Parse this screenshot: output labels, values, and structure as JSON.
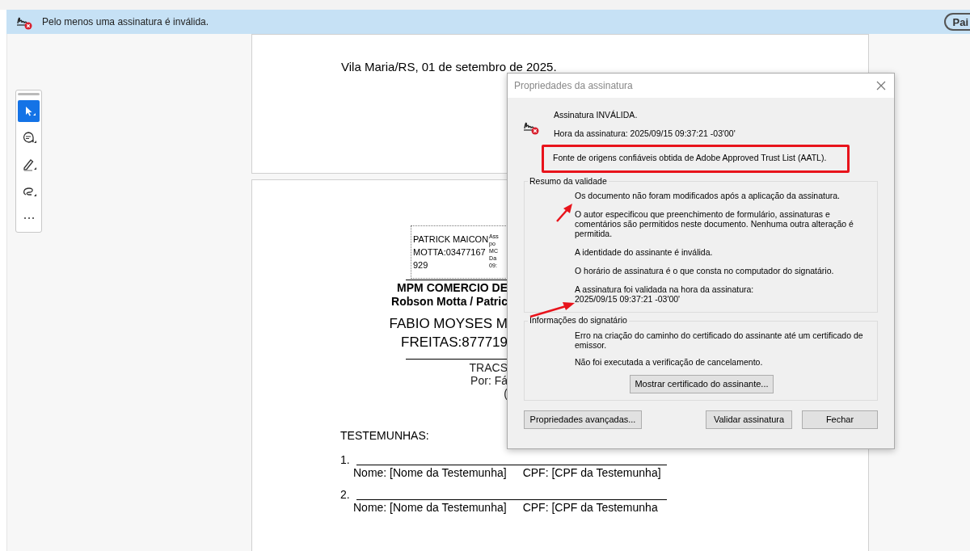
{
  "banner": {
    "message": "Pelo menos uma assinatura é inválida.",
    "button": "Pai"
  },
  "toolbar": {
    "tools": [
      {
        "kind": "select",
        "selected": true
      },
      {
        "kind": "comment",
        "selected": false
      },
      {
        "kind": "draw",
        "selected": false
      },
      {
        "kind": "lasso",
        "selected": false
      },
      {
        "kind": "more",
        "selected": false
      }
    ]
  },
  "document": {
    "place_date": "Vila Maria/RS, 01 de setembro de 2025.",
    "stamp": {
      "signer_lines": [
        "PATRICK MAICON",
        "MOTTA:03477167",
        "929"
      ],
      "detail_lines": [
        "Ass",
        "po",
        "MC",
        "Da",
        "09:"
      ]
    },
    "company_lines": [
      "MPM COMERCIO DE",
      "Robson Motta / Patric"
    ],
    "second_signer_lines": [
      "FABIO MOYSES M",
      "FREITAS:877719"
    ],
    "caption_lines": [
      "TRACS",
      "Por: Fá",
      "("
    ],
    "witnesses_title": "TESTEMUNHAS:",
    "witnesses": [
      {
        "number": "1.",
        "name": "Nome: [Nome da Testemunha]",
        "cpf": "CPF: [CPF da Testemunha]"
      },
      {
        "number": "2.",
        "name": "Nome: [Nome da Testemunha]",
        "cpf": "CPF: [CPF da Testemunha"
      }
    ]
  },
  "dialog": {
    "title": "Propriedades da assinatura",
    "status": "Assinatura INVÁLIDA.",
    "time": "Hora da assinatura:  2025/09/15 09:37:21 -03'00'",
    "trust_source": "Fonte de origens confiáveis obtida de Adobe Approved Trust List (AATL).",
    "validity": {
      "legend": "Resumo da validade",
      "items": [
        "Os documento não foram modificados após a aplicação da assinatura.",
        "O autor especificou que preenchimento de formulário, assinaturas e comentários são permitidos neste documento. Nenhuma outra alteração é permitida.",
        "A identidade do assinante é inválida.",
        "O horário de assinatura é o que consta no computador do signatário.",
        "A assinatura foi validada na hora da assinatura:\n2025/09/15 09:37:21 -03'00'"
      ]
    },
    "signer": {
      "legend": "Informações do signatário",
      "items": [
        "Erro na criação do caminho do certificado do assinante até um certificado de emissor.",
        "Não foi executada a verificação de cancelamento."
      ],
      "button": "Mostrar certificado do assinante..."
    },
    "buttons": [
      "Propriedades avançadas...",
      "Validar assinatura",
      "Fechar"
    ]
  }
}
